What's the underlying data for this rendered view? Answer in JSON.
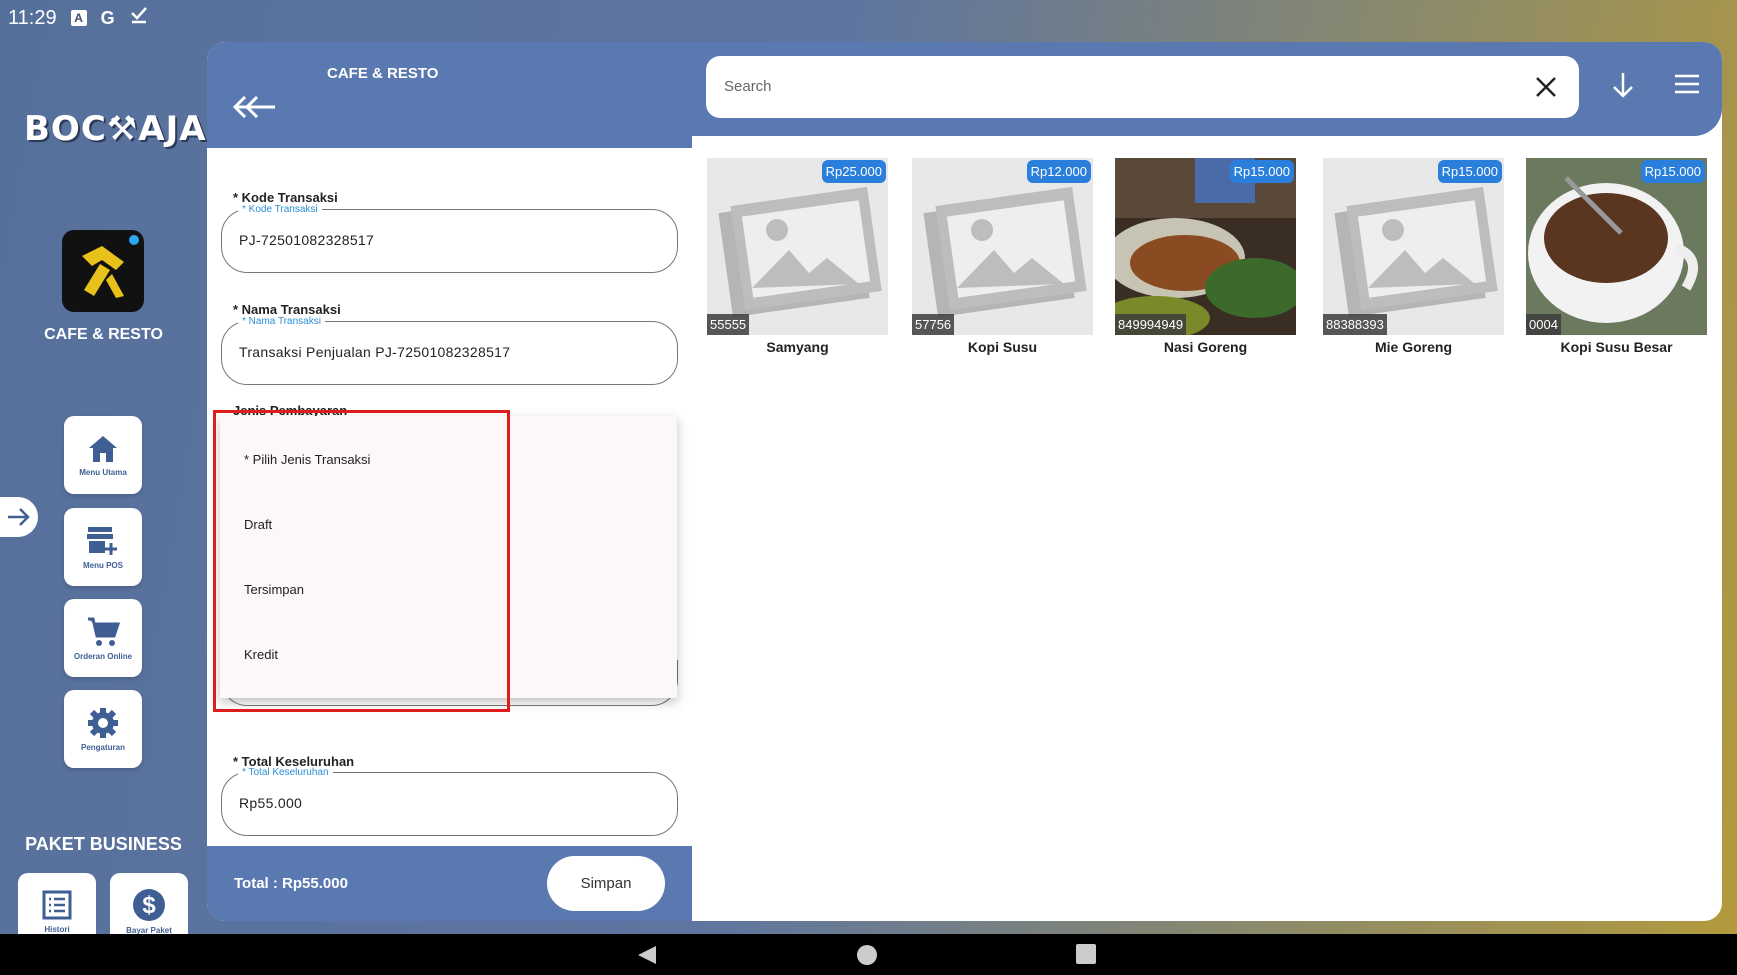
{
  "status_bar": {
    "time": "11:29",
    "icons": [
      "a-icon",
      "google-icon",
      "check-icon"
    ],
    "a_glyph": "A",
    "g_glyph": "G"
  },
  "sidebar": {
    "logo_text": "BOC⚒AJA",
    "app_label": "CAFE & RESTO",
    "buttons": [
      {
        "label": "Menu Utama",
        "icon": "home-icon"
      },
      {
        "label": "Menu POS",
        "icon": "store-add-icon"
      },
      {
        "label": "Orderan Online",
        "icon": "cart-icon"
      },
      {
        "label": "Pengaturan",
        "icon": "gear-icon"
      }
    ],
    "paket_label": "PAKET BUSINESS",
    "bottom_buttons": [
      {
        "label": "Histori",
        "icon": "list-icon"
      },
      {
        "label": "Bayar Paket",
        "icon": "dollar-icon"
      }
    ]
  },
  "form": {
    "title": "CAFE & RESTO",
    "fields": {
      "kode": {
        "label": "* Kode Transaksi",
        "hint": "* Kode Transaksi",
        "value": "PJ-72501082328517"
      },
      "nama": {
        "label": "* Nama Transaksi",
        "hint": "* Nama Transaksi",
        "value": "Transaksi Penjualan PJ-72501082328517"
      },
      "jenis": {
        "label": "Jenis Pembayaran"
      },
      "total": {
        "label": "* Total Keseluruhan",
        "hint": "* Total Keseluruhan",
        "value": "Rp55.000"
      }
    },
    "footer": {
      "total_text": "Total :  Rp55.000",
      "save_label": "Simpan"
    }
  },
  "dropdown": {
    "options": [
      "* Pilih Jenis Transaksi",
      "Draft",
      "Tersimpan",
      "Kredit"
    ]
  },
  "products": {
    "search_placeholder": "Search",
    "items": [
      {
        "name": "Samyang",
        "code": "55555",
        "price": "Rp25.000",
        "image": "placeholder"
      },
      {
        "name": "Kopi Susu",
        "code": "57756",
        "price": "Rp12.000",
        "image": "placeholder"
      },
      {
        "name": "Nasi Goreng",
        "code": "849994949",
        "price": "Rp15.000",
        "image": "photo-food"
      },
      {
        "name": "Mie Goreng",
        "code": "88388393",
        "price": "Rp15.000",
        "image": "placeholder"
      },
      {
        "name": "Kopi Susu Besar",
        "code": "0004",
        "price": "Rp15.000",
        "image": "photo-coffee"
      }
    ]
  },
  "colors": {
    "header": "#5a79b0",
    "price_badge": "#2a7fdc",
    "highlight": "#e01b1b"
  }
}
